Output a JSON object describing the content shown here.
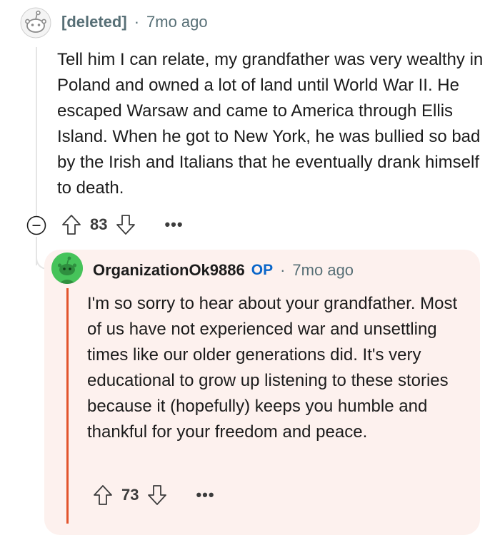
{
  "comment": {
    "author": "[deleted]",
    "separator": "·",
    "time": "7mo ago",
    "body": "Tell him I can relate, my grandfather was very wealthy in Poland and owned a lot of land until World War II. He escaped Warsaw and came to America through Ellis Island. When he got to New York, he was bullied so bad by the Irish and Italians that he eventually drank himself to death.",
    "votes": "83",
    "collapse_icon": "minus-circle-icon",
    "more_label": "•••"
  },
  "reply": {
    "author": "OrganizationOk9886",
    "op_badge": "OP",
    "separator": "·",
    "time": "7mo ago",
    "body": "I'm so sorry to hear about your grandfather. Most of us have not experienced war and unsettling times like our older generations did. It's very educational to grow up listening to these stories because it (hopefully) keeps you humble and thankful for your freedom and peace.",
    "votes": "73",
    "more_label": "•••"
  },
  "colors": {
    "op_accent": "#e2542c",
    "op_badge": "#0a66c9",
    "reply_background": "#fdf1ee",
    "avatar_green": "#46c35a"
  }
}
